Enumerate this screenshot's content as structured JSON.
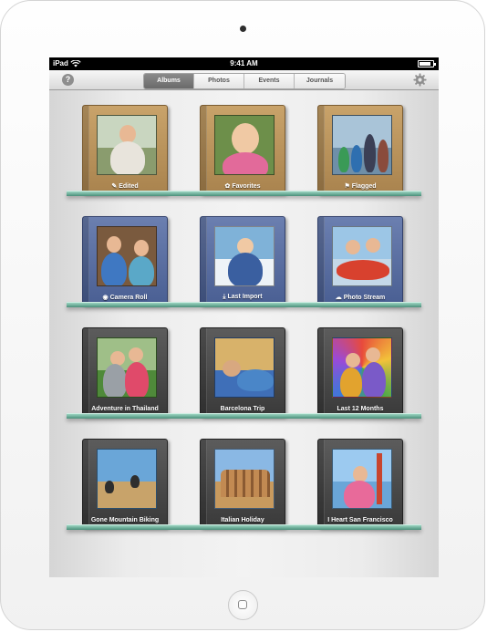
{
  "status_bar": {
    "carrier": "iPad",
    "time": "9:41 AM",
    "battery_level": 0.85
  },
  "toolbar": {
    "help_icon": "help-icon",
    "settings_icon": "gear-icon",
    "segments": [
      {
        "label": "Albums",
        "selected": true
      },
      {
        "label": "Photos",
        "selected": false
      },
      {
        "label": "Events",
        "selected": false
      },
      {
        "label": "Journals",
        "selected": false
      }
    ]
  },
  "albums": [
    {
      "label": "Edited",
      "icon": "edit-icon",
      "cover": "tan"
    },
    {
      "label": "Favorites",
      "icon": "favorite-badge-icon",
      "cover": "tan"
    },
    {
      "label": "Flagged",
      "icon": "flag-icon",
      "cover": "tan"
    },
    {
      "label": "Camera Roll",
      "icon": "camera-icon",
      "cover": "blue"
    },
    {
      "label": "Last Import",
      "icon": "import-icon",
      "cover": "blue"
    },
    {
      "label": "Photo Stream",
      "icon": "cloud-icon",
      "cover": "blue"
    },
    {
      "label": "Adventure in Thailand",
      "icon": "",
      "cover": "dark"
    },
    {
      "label": "Barcelona Trip",
      "icon": "",
      "cover": "dark"
    },
    {
      "label": "Last 12 Months",
      "icon": "",
      "cover": "dark"
    },
    {
      "label": "Gone Mountain Biking",
      "icon": "",
      "cover": "dark"
    },
    {
      "label": "Italian Holiday",
      "icon": "",
      "cover": "dark"
    },
    {
      "label": "I Heart San Francisco",
      "icon": "",
      "cover": "dark"
    }
  ],
  "colors": {
    "shelf_glass": "#4a8f7a",
    "tan_cover": "#b48d57",
    "blue_cover": "#5a6ea2",
    "dark_cover": "#4a4a4a"
  }
}
